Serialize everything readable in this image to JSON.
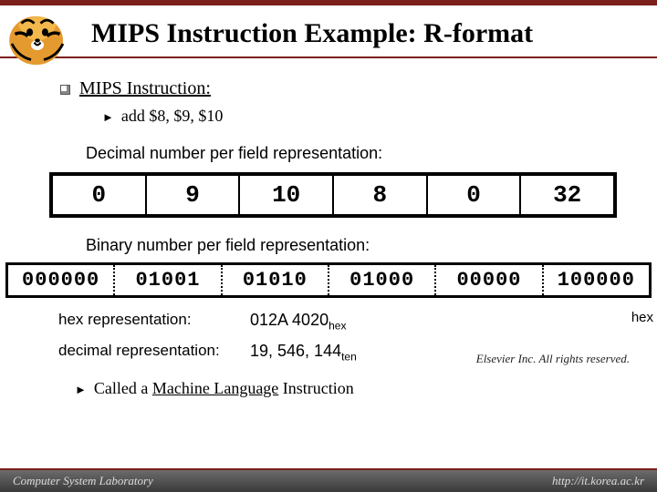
{
  "title": "MIPS Instruction Example: R-format",
  "section": "MIPS Instruction:",
  "instruction": "add   $8, $9, $10",
  "labels": {
    "decimal": "Decimal number per field representation:",
    "binary": "Binary number per field representation:",
    "hex": "hex representation:",
    "dec_repr": "decimal representation:",
    "machine": "Called a Machine Language Instruction"
  },
  "chart_data": {
    "type": "table",
    "decimal_fields": [
      "0",
      "9",
      "10",
      "8",
      "0",
      "32"
    ],
    "binary_fields": [
      "000000",
      "01001",
      "01010",
      "01000",
      "00000",
      "100000"
    ]
  },
  "hex_value": "012A 4020",
  "hex_sub": "hex",
  "dec_value": "19, 546, 144",
  "dec_sub": "ten",
  "trail_hex": "hex",
  "copyright": "Elsevier Inc. All rights reserved.",
  "footer": {
    "left": "Computer System Laboratory",
    "right": "http://it.korea.ac.kr"
  }
}
